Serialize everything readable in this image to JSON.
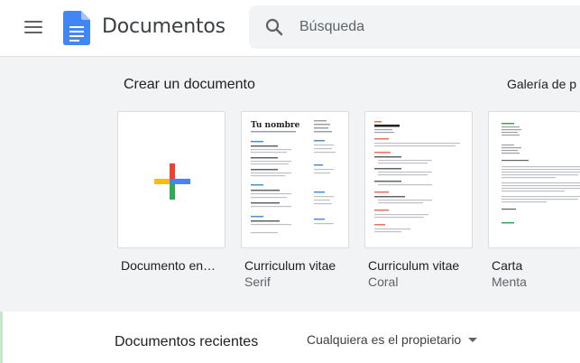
{
  "header": {
    "app_title": "Documentos",
    "menu_icon": "hamburger-menu-icon",
    "logo_icon": "docs-logo-icon",
    "search": {
      "placeholder": "Búsqueda",
      "value": "",
      "icon": "search-icon"
    }
  },
  "gallery": {
    "title": "Crear un documento",
    "gallery_link": "Galería de p",
    "templates": [
      {
        "title": "Documento en…",
        "subtitle": "",
        "icon": "colorful-plus-icon"
      },
      {
        "title": "Curriculum vitae",
        "subtitle": "Serif",
        "preview_heading": "Tu nombre"
      },
      {
        "title": "Curriculum vitae",
        "subtitle": "Coral"
      },
      {
        "title": "Carta",
        "subtitle": "Menta"
      }
    ]
  },
  "recent": {
    "title": "Documentos recientes",
    "owner_filter": "Cualquiera es el propietario"
  },
  "colors": {
    "gallery_bg": "#f1f3f4",
    "docs_blue": "#4285f4",
    "plus_red": "#ea4335",
    "plus_yellow": "#fbbc04",
    "plus_green": "#34a853",
    "plus_blue": "#4285f4",
    "coral_accent": "#e8715a",
    "mint_accent": "#34a853"
  }
}
